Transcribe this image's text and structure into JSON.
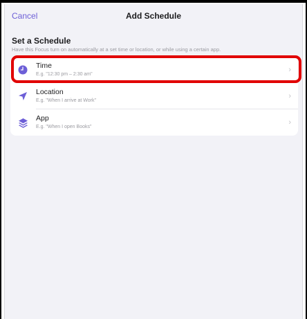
{
  "nav": {
    "cancel_label": "Cancel",
    "title": "Add Schedule"
  },
  "section": {
    "title": "Set a Schedule",
    "description": "Have this Focus turn on automatically at a set time or location, or while using a certain app."
  },
  "rows": [
    {
      "label": "Time",
      "sub": "E.g. \"12:30 pm – 2:30 am\"",
      "icon": "clock-icon"
    },
    {
      "label": "Location",
      "sub": "E.g. \"When I arrive at Work\"",
      "icon": "location-arrow-icon"
    },
    {
      "label": "App",
      "sub": "E.g. \"When I open Books\"",
      "icon": "app-layers-icon"
    }
  ],
  "chevron": "›",
  "colors": {
    "accent": "#6d5fd7",
    "highlight": "#e10000",
    "background": "#f2f2f7"
  }
}
